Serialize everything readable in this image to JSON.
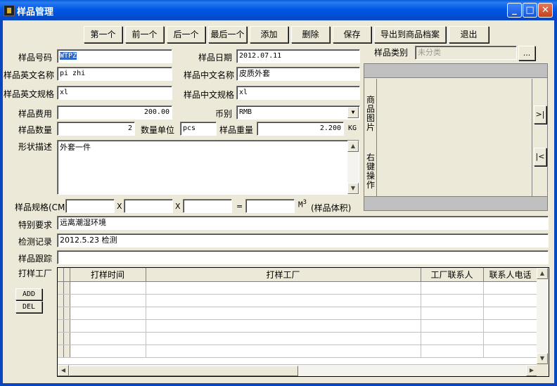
{
  "window": {
    "title": "样品管理"
  },
  "toolbar": {
    "first": "第一个",
    "prev": "前一个",
    "next": "后一个",
    "last": "最后一个",
    "add": "添加",
    "delete": "删除",
    "save": "保存",
    "export": "导出到商品档案",
    "exit": "退出"
  },
  "form": {
    "sample_no_label": "样品号码",
    "sample_no_value": "WTPZ",
    "sample_date_label": "样品日期",
    "sample_date_value": "2012.07.11",
    "category_label": "样品类别",
    "category_value": "未分类",
    "category_button": "...",
    "en_name_label": "样品英文名称",
    "en_name_value": "pi zhi",
    "cn_name_label": "样品中文名称",
    "cn_name_value": "皮质外套",
    "en_spec_label": "样品英文规格",
    "en_spec_value": "xl",
    "cn_spec_label": "样品中文规格",
    "cn_spec_value": "xl",
    "fee_label": "样品费用",
    "fee_value": "200.00",
    "currency_label": "币别",
    "currency_value": "RMB",
    "qty_label": "样品数量",
    "qty_value": "2",
    "unit_label": "数量单位",
    "unit_value": "pcs",
    "weight_label": "样品重量",
    "weight_value": "2.200",
    "weight_unit": "KG",
    "shape_label": "形状描述",
    "shape_value": "外套一件",
    "size_label": "样品规格(CM)",
    "size_x1": "X",
    "size_x2": "X",
    "size_eq": "=",
    "volume_unit_base": "M",
    "volume_unit_exp": "3",
    "volume_label": "(样品体积)",
    "special_label": "特别要求",
    "special_value": "远离潮湿环境",
    "inspection_label": "检测记录",
    "inspection_value": "2012.5.23 检测",
    "tracking_label": "样品跟踪",
    "tracking_value": "",
    "factory_label": "打样工厂"
  },
  "image_panel": {
    "top_label": "商品图片",
    "bottom_label": "右键操作",
    "next_btn": ">|",
    "prev_btn": "|<"
  },
  "grid": {
    "add_btn": "ADD",
    "del_btn": "DEL",
    "columns": [
      "打样时间",
      "打样工厂",
      "工厂联系人",
      "联系人电话"
    ]
  }
}
